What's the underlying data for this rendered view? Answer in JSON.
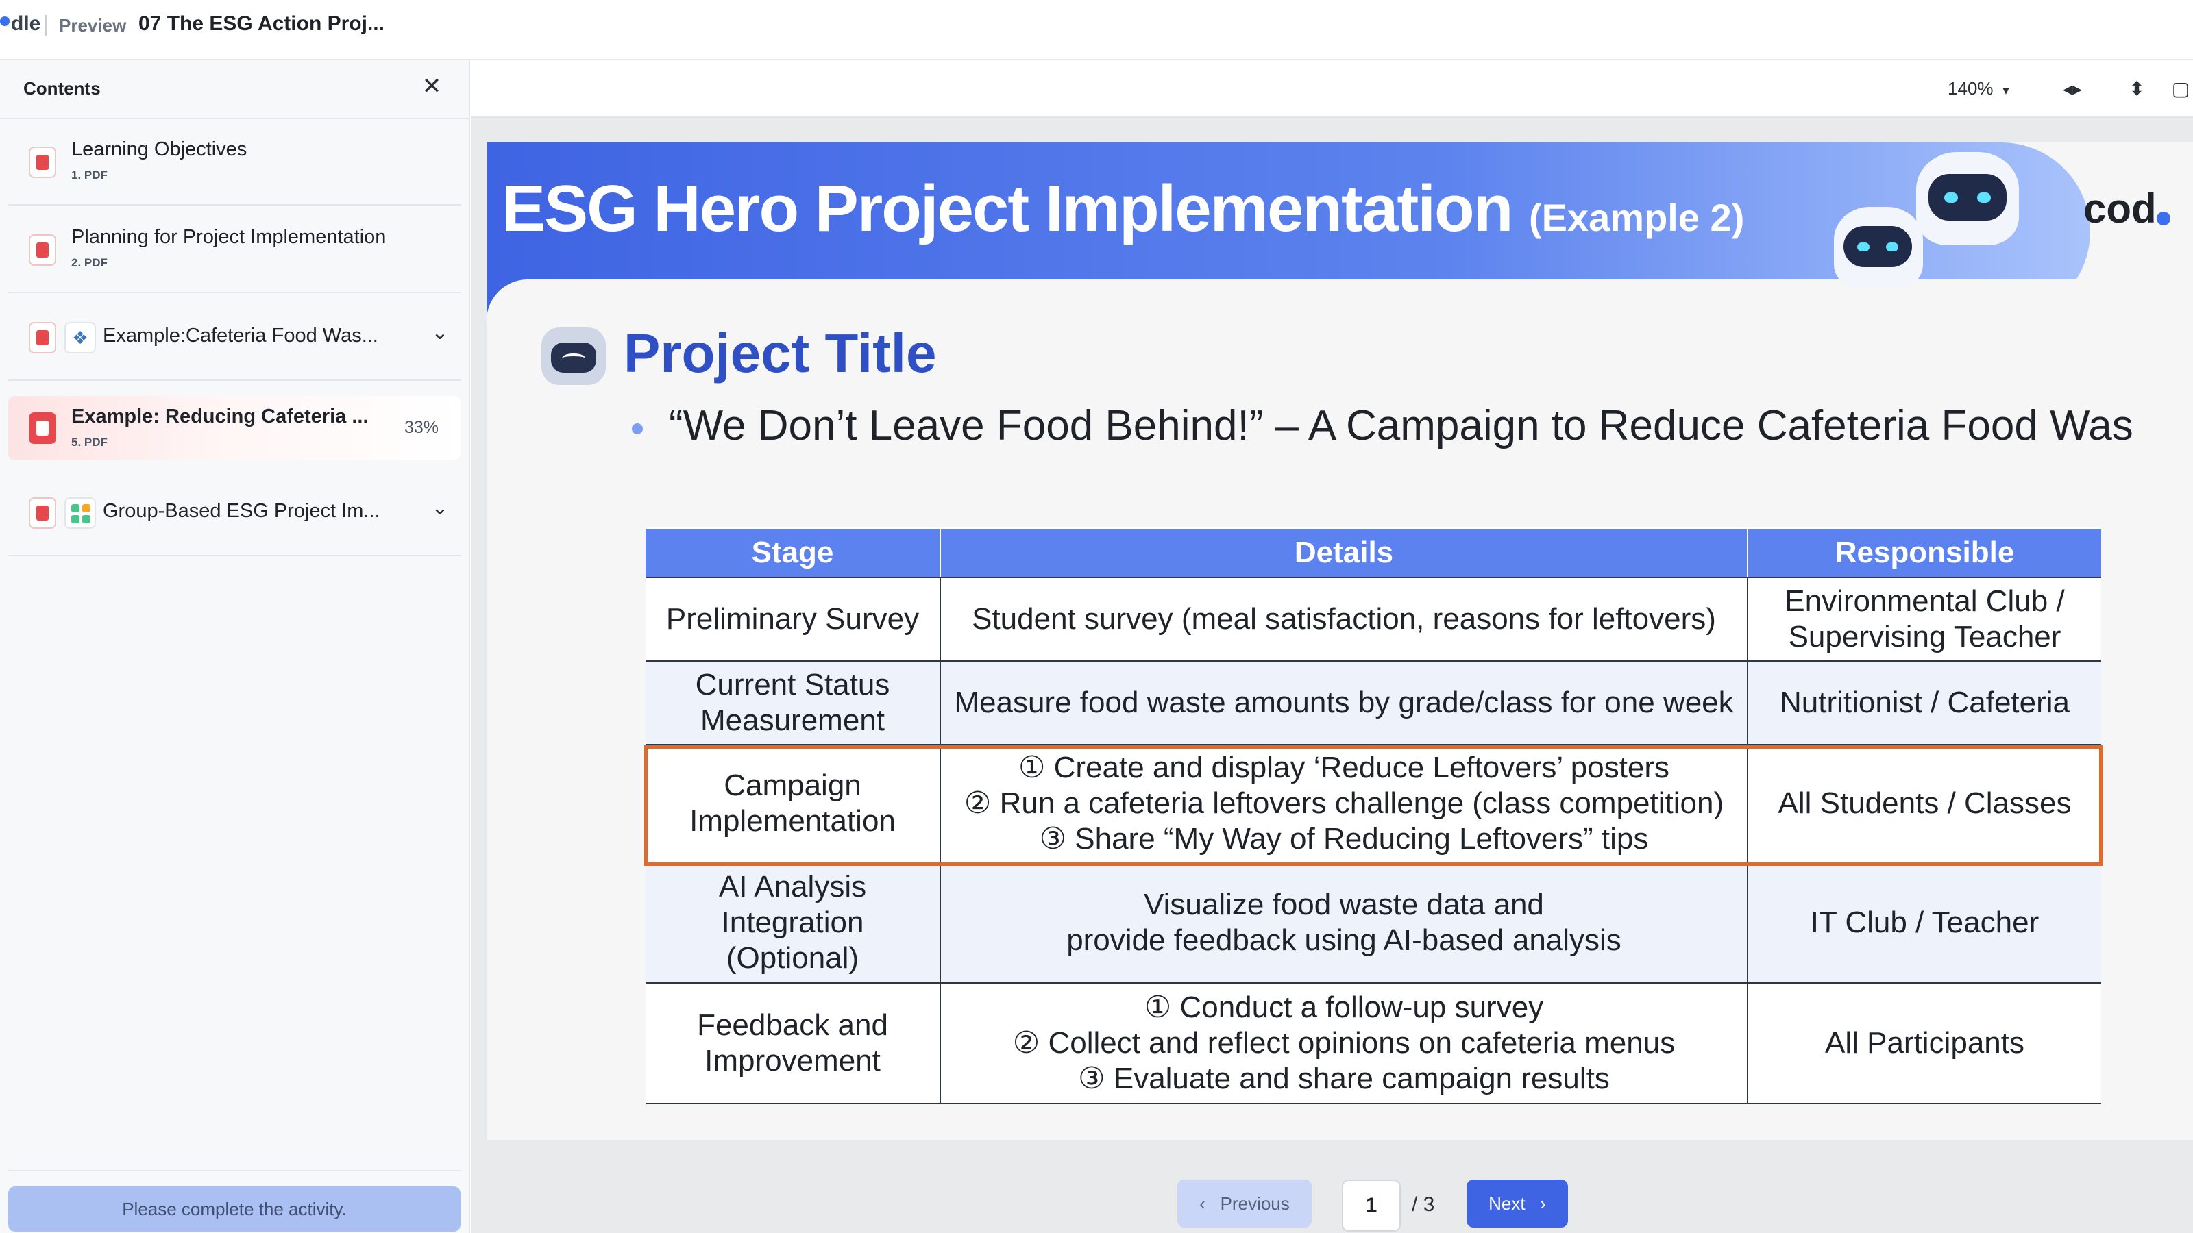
{
  "app": {
    "brand": "dle",
    "preview_label": "Preview",
    "doc_title": "07 The ESG Action Proj..."
  },
  "sidebar": {
    "title": "Contents",
    "items": [
      {
        "name": "Learning Objectives",
        "sub": "1. PDF",
        "icons": [
          "pdf-icon"
        ]
      },
      {
        "name": "Planning for Project Implementation",
        "sub": "2. PDF",
        "icons": [
          "pdf-icon"
        ]
      },
      {
        "name": "Example:Cafeteria Food Was...",
        "sub": "",
        "icons": [
          "pdf-icon",
          "python-icon"
        ],
        "expandable": true
      },
      {
        "name": "Example: Reducing Cafeteria ...",
        "sub": "5. PDF",
        "progress": "33%",
        "active": true,
        "icons": [
          "pdf-icon"
        ]
      },
      {
        "name": "Group-Based ESG Project Im...",
        "sub": "",
        "icons": [
          "pdf-icon",
          "group-icon"
        ],
        "expandable": true
      }
    ],
    "complete_button": "Please complete the activity."
  },
  "toolbar": {
    "zoom": "140%"
  },
  "slide": {
    "banner_title": "ESG Hero Project Implementation",
    "banner_example": "(Example 2)",
    "logo_text": "cod",
    "project_title": "Project Title",
    "subtitle": "“We Don’t Leave Food Behind!” – A Campaign to Reduce Cafeteria Food Was",
    "table": {
      "headers": [
        "Stage",
        "Details",
        "Responsible"
      ],
      "rows": [
        {
          "stage": [
            "Preliminary Survey"
          ],
          "details": [
            "Student survey (meal satisfaction, reasons for leftovers)"
          ],
          "responsible": [
            "Environmental Club /",
            "Supervising Teacher"
          ]
        },
        {
          "stage": [
            "Current Status",
            "Measurement"
          ],
          "details": [
            "Measure food waste amounts by grade/class for one week"
          ],
          "responsible": [
            "Nutritionist / Cafeteria"
          ]
        },
        {
          "stage": [
            "Campaign",
            "Implementation"
          ],
          "details": [
            "① Create and display ‘Reduce Leftovers’ posters",
            "② Run a cafeteria leftovers challenge (class competition)",
            "③ Share “My Way of Reducing Leftovers” tips"
          ],
          "responsible": [
            "All Students / Classes"
          ],
          "highlighted": true
        },
        {
          "stage": [
            "AI Analysis",
            "Integration",
            "(Optional)"
          ],
          "details": [
            "Visualize food waste data and",
            "provide feedback using AI-based analysis"
          ],
          "responsible": [
            "IT Club / Teacher"
          ]
        },
        {
          "stage": [
            "Feedback and",
            "Improvement"
          ],
          "details": [
            "① Conduct a follow-up survey",
            "② Collect and reflect opinions on cafeteria menus",
            "③ Evaluate and share campaign results"
          ],
          "responsible": [
            "All Participants"
          ]
        }
      ]
    }
  },
  "pager": {
    "prev_label": "Previous",
    "current_page": "1",
    "total": "/ 3",
    "next_label": "Next"
  },
  "colors": {
    "accent": "#3f64e3",
    "table_header": "#5b82ee",
    "highlight_border": "#e06a2c",
    "active_item_bg": "#fde3e3",
    "pdf_red": "#e5484d"
  }
}
